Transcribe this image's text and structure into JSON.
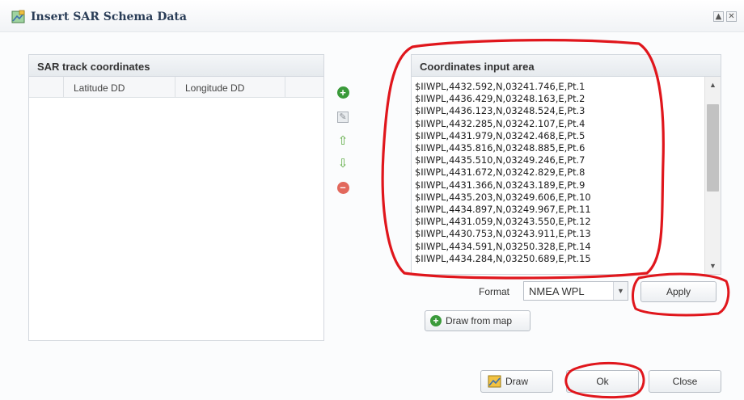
{
  "window": {
    "title": "Insert SAR Schema Data",
    "restore_glyph": "▲",
    "close_glyph": "✕"
  },
  "left_panel": {
    "title": "SAR track coordinates",
    "columns": [
      "",
      "Latitude DD",
      "Longitude DD",
      ""
    ]
  },
  "side_toolbar": [
    {
      "name": "add-row-button",
      "icon": "plus-circle-icon",
      "glyph": "+",
      "color": "#3a9a3a"
    },
    {
      "name": "edit-row-button",
      "icon": "edit-icon",
      "glyph": "✎",
      "color": "#8a8f95"
    },
    {
      "name": "move-up-button",
      "icon": "arrow-up-icon",
      "glyph": "⇧",
      "color": "#58a83c"
    },
    {
      "name": "move-down-button",
      "icon": "arrow-down-icon",
      "glyph": "⇩",
      "color": "#58a83c"
    },
    {
      "name": "remove-row-button",
      "icon": "minus-circle-icon",
      "glyph": "–",
      "color": "#e2685c"
    }
  ],
  "right_panel": {
    "title": "Coordinates input area",
    "lines": [
      "$IIWPL,4432.592,N,03241.746,E,Pt.1",
      "$IIWPL,4436.429,N,03248.163,E,Pt.2",
      "$IIWPL,4436.123,N,03248.524,E,Pt.3",
      "$IIWPL,4432.285,N,03242.107,E,Pt.4",
      "$IIWPL,4431.979,N,03242.468,E,Pt.5",
      "$IIWPL,4435.816,N,03248.885,E,Pt.6",
      "$IIWPL,4435.510,N,03249.246,E,Pt.7",
      "$IIWPL,4431.672,N,03242.829,E,Pt.8",
      "$IIWPL,4431.366,N,03243.189,E,Pt.9",
      "$IIWPL,4435.203,N,03249.606,E,Pt.10",
      "$IIWPL,4434.897,N,03249.967,E,Pt.11",
      "$IIWPL,4431.059,N,03243.550,E,Pt.12",
      "$IIWPL,4430.753,N,03243.911,E,Pt.13",
      "$IIWPL,4434.591,N,03250.328,E,Pt.14",
      "$IIWPL,4434.284,N,03250.689,E,Pt.15"
    ]
  },
  "format": {
    "label": "Format",
    "selected": "NMEA WPL"
  },
  "buttons": {
    "apply": "Apply",
    "draw_from_map": "Draw from map",
    "draw": "Draw",
    "ok": "Ok",
    "close": "Close"
  },
  "colors": {
    "annotation": "#e0161c",
    "header_text": "#2a3d57"
  }
}
